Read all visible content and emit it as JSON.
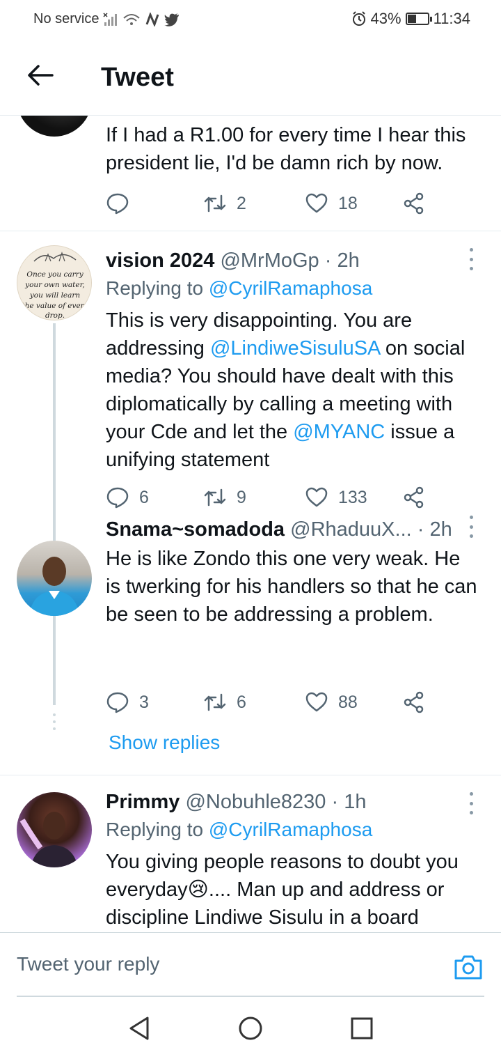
{
  "status_bar": {
    "carrier": "No service",
    "battery": "43%",
    "battery_level": 0.43,
    "time": "11:34"
  },
  "header": {
    "title": "Tweet"
  },
  "tweets": [
    {
      "body": "If I had a R1.00 for every time I hear this president lie, I'd be damn rich by now.",
      "replies": "",
      "retweets": "2",
      "likes": "18"
    },
    {
      "name": "vision 2024",
      "handle": "@MrMoGp",
      "time": "· 2h",
      "avatar_text": "Once you carry your own water, you will learn the value of every drop.",
      "replying_label": "Replying to",
      "replying_to": "@CyrilRamaphosa",
      "body_parts": [
        "This is very disappointing. You are addressing ",
        "@LindiweSisuluSA",
        " on social media? You should have dealt with this diplomatically by calling a meeting with your Cde and let the ",
        "@MYANC",
        " issue a unifying statement"
      ],
      "replies": "6",
      "retweets": "9",
      "likes": "133"
    },
    {
      "name": "Snama~somadoda",
      "handle": "@RhaduuX...",
      "time": "· 2h",
      "body": "He is like Zondo this one very weak. He is twerking for his handlers so that he can be seen to be addressing a problem.",
      "replies": "3",
      "retweets": "6",
      "likes": "88"
    },
    {
      "name": "Primmy",
      "handle": "@Nobuhle8230",
      "time": "· 1h",
      "replying_label": "Replying to",
      "replying_to": "@CyrilRamaphosa",
      "body_parts": [
        "You giving people reasons to doubt you everyday",
        "😢",
        ".... Man up and address or discipline Lindiwe Sisulu in a board"
      ]
    }
  ],
  "show_replies": "Show replies",
  "reply_bar": {
    "placeholder": "Tweet your reply"
  },
  "icons": {
    "back": "arrow-left-icon",
    "reply": "speech-bubble-icon",
    "retweet": "retweet-icon",
    "like": "heart-icon",
    "share": "share-icon",
    "camera": "camera-icon",
    "nav_back": "triangle-back-icon",
    "nav_home": "circle-home-icon",
    "nav_recents": "square-recents-icon"
  },
  "colors": {
    "link": "#1d9bf0",
    "secondary_text": "#536471",
    "divider": "#e6ecf0"
  }
}
